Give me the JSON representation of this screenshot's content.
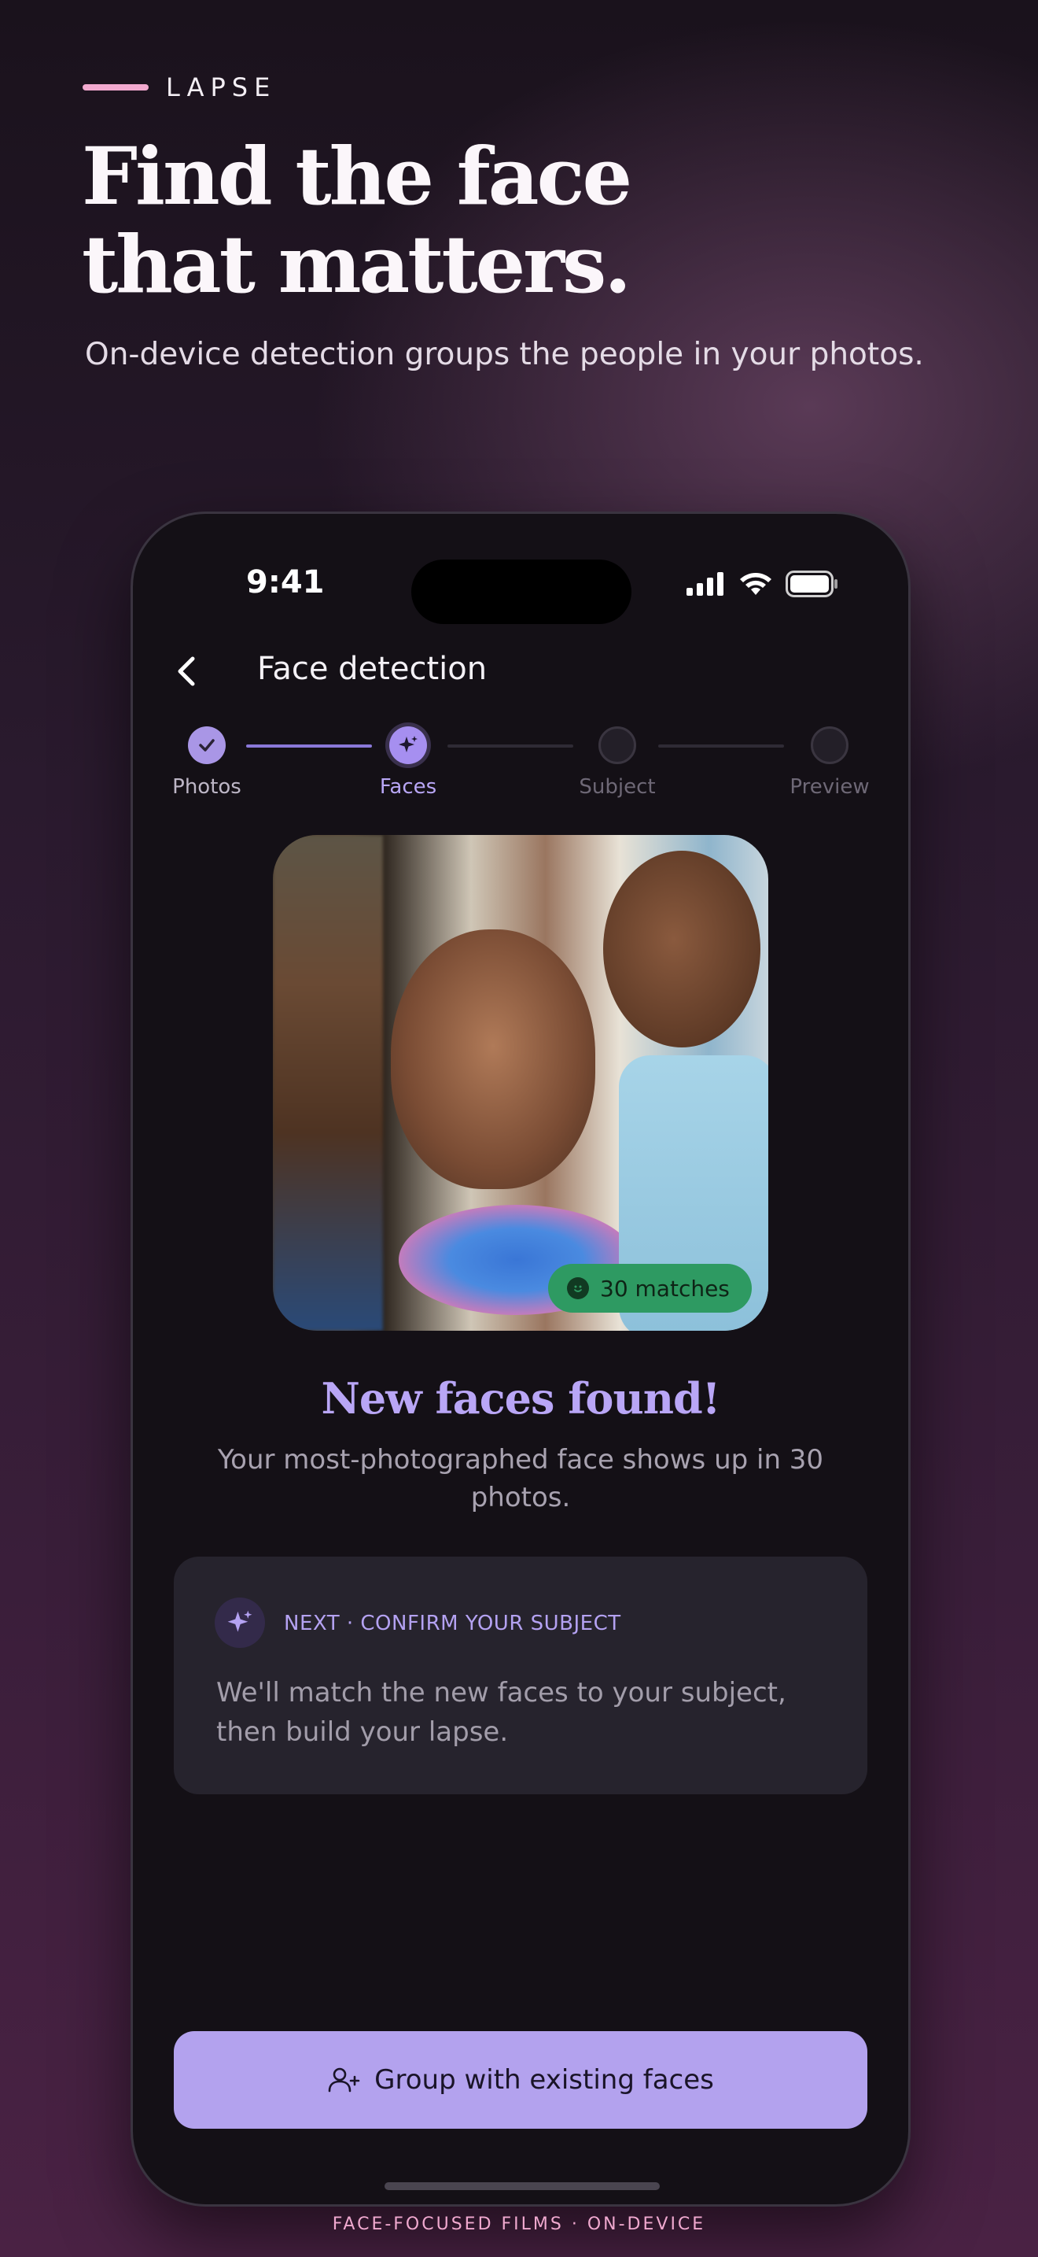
{
  "brand": {
    "name": "LAPSE",
    "accent": "#f2a9cf"
  },
  "hero": {
    "title": "Find the face\nthat matters.",
    "subtitle": "On-device detection groups the people in your photos."
  },
  "status_bar": {
    "time": "9:41",
    "icons": [
      "cellular-signal-icon",
      "wifi-icon",
      "battery-icon"
    ]
  },
  "screen": {
    "title": "Face detection",
    "back_icon": "chevron-left-icon",
    "steps": [
      {
        "label": "Photos",
        "state": "done",
        "icon": "check-icon"
      },
      {
        "label": "Faces",
        "state": "active",
        "icon": "sparkle-icon"
      },
      {
        "label": "Subject",
        "state": "todo"
      },
      {
        "label": "Preview",
        "state": "todo"
      }
    ],
    "photo_badge": {
      "label": "30 matches",
      "icon": "smile-icon",
      "color": "#2e9a62"
    },
    "result": {
      "title": "New faces found!",
      "subtitle": "Your most-photographed face shows up in 30 photos."
    },
    "next_card": {
      "icon": "sparkle-icon",
      "label": "NEXT · CONFIRM YOUR SUBJECT",
      "text": "We'll match the new faces to your subject, then build your lapse."
    },
    "primary_button": {
      "label": "Group with existing faces",
      "icon": "add-person-icon",
      "color": "#b3a2ee"
    }
  },
  "footer": {
    "text": "FACE-FOCUSED FILMS · ON-DEVICE"
  }
}
